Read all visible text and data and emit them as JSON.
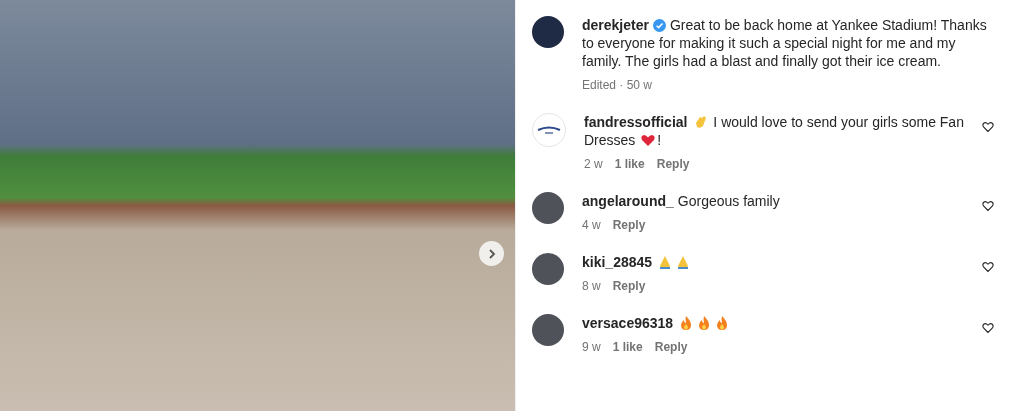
{
  "post": {
    "next_button": true
  },
  "caption": {
    "username": "derekjeter",
    "verified": true,
    "text": "Great to be back home at Yankee Stadium! Thanks to everyone for making it such a special night for me and my family. The girls had a blast and finally got their ice cream.",
    "meta": "Edited · 50 w"
  },
  "comments": [
    {
      "username": "fandressofficial",
      "kind": "logo",
      "parts": [
        {
          "kind": "clap"
        },
        {
          "kind": "text",
          "text": " I would love to send your girls some Fan Dresses "
        },
        {
          "kind": "heart"
        },
        {
          "kind": "text",
          "text": "!"
        }
      ],
      "age": "2 w",
      "likes": "1 like",
      "reply": "Reply"
    },
    {
      "username": "angelaround_",
      "kind": "photo",
      "parts": [
        {
          "kind": "text",
          "text": "Gorgeous family"
        }
      ],
      "age": "4 w",
      "reply": "Reply"
    },
    {
      "username": "kiki_28845",
      "kind": "photo",
      "parts": [
        {
          "kind": "pray"
        },
        {
          "kind": "pray"
        }
      ],
      "age": "8 w",
      "reply": "Reply"
    },
    {
      "username": "versace96318",
      "kind": "photo",
      "parts": [
        {
          "kind": "fire"
        },
        {
          "kind": "fire"
        },
        {
          "kind": "fire"
        }
      ],
      "age": "9 w",
      "likes": "1 like",
      "reply": "Reply"
    }
  ]
}
